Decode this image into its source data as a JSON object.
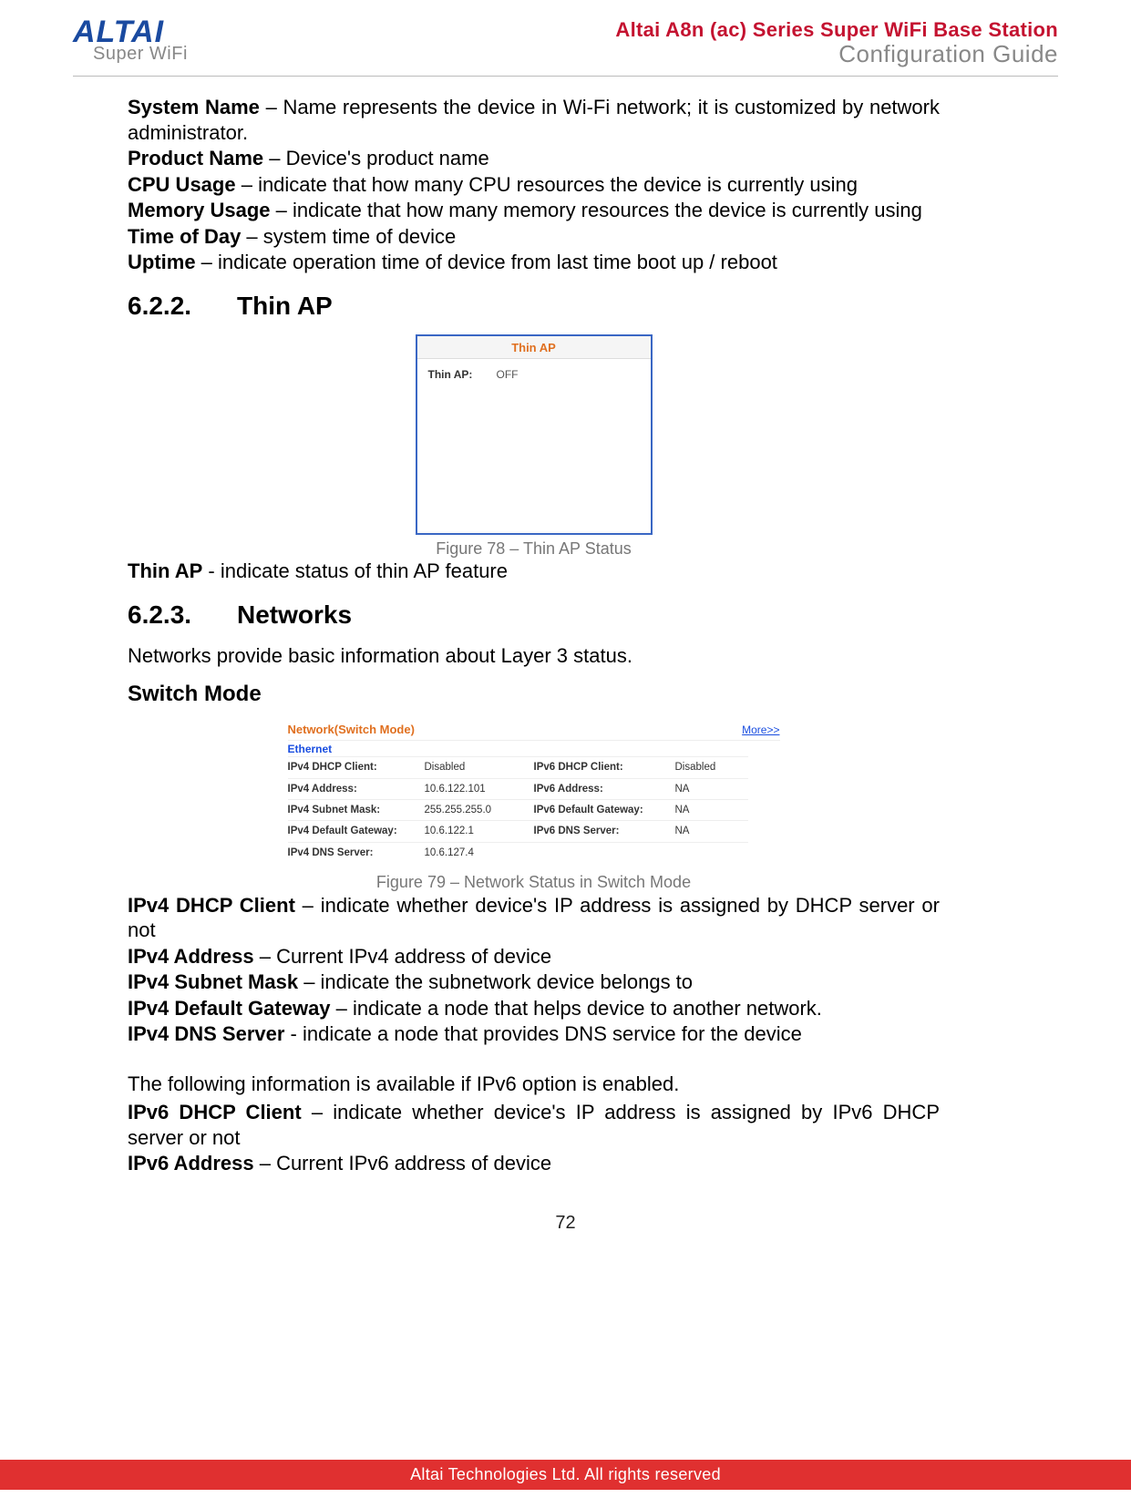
{
  "header": {
    "logo_main": "ALTAI",
    "logo_sub": "Super WiFi",
    "title1": "Altai A8n (ac) Series Super WiFi Base Station",
    "title2": "Configuration Guide"
  },
  "defs1": [
    {
      "term": "System Name",
      "sep": " – ",
      "text": "Name represents the device in Wi-Fi network; it is customized by network administrator."
    },
    {
      "term": "Product Name",
      "sep": " – ",
      "text": "Device's product name"
    },
    {
      "term": "CPU Usage",
      "sep": " – ",
      "text": "indicate that how many CPU resources the device is currently using"
    },
    {
      "term": "Memory Usage",
      "sep": " – ",
      "text": "indicate that how many memory resources the device is currently using"
    },
    {
      "term": "Time of Day",
      "sep": " – ",
      "text": "system time of device"
    },
    {
      "term": "Uptime",
      "sep": " – ",
      "text": "indicate operation time of device from last time boot up / reboot"
    }
  ],
  "section_622": {
    "num": "6.2.2.",
    "title": "Thin AP"
  },
  "thinap_panel": {
    "heading": "Thin AP",
    "label": "Thin AP:",
    "value": "OFF"
  },
  "fig78": "Figure 78 – Thin AP Status",
  "def_thinap": {
    "term": "Thin AP",
    "sep": " - ",
    "text": "indicate status of thin AP feature"
  },
  "section_623": {
    "num": "6.2.3.",
    "title": "Networks"
  },
  "networks_intro": "Networks provide basic information about Layer 3 status.",
  "switch_mode_heading": "Switch Mode",
  "net_panel": {
    "heading": "Network(Switch Mode)",
    "more": "More>>",
    "ethernet": "Ethernet",
    "rows": [
      {
        "l1": "IPv4 DHCP Client:",
        "v1": "Disabled",
        "l2": "IPv6 DHCP Client:",
        "v2": "Disabled"
      },
      {
        "l1": "IPv4 Address:",
        "v1": "10.6.122.101",
        "l2": "IPv6 Address:",
        "v2": "NA"
      },
      {
        "l1": "IPv4 Subnet Mask:",
        "v1": "255.255.255.0",
        "l2": "IPv6 Default Gateway:",
        "v2": "NA"
      },
      {
        "l1": "IPv4 Default Gateway:",
        "v1": "10.6.122.1",
        "l2": "IPv6 DNS Server:",
        "v2": "NA"
      },
      {
        "l1": "IPv4 DNS Server:",
        "v1": "10.6.127.4",
        "l2": "",
        "v2": ""
      }
    ]
  },
  "fig79": "Figure 79 – Network Status in Switch Mode",
  "defs2": [
    {
      "term": "IPv4 DHCP Client",
      "sep": " – ",
      "text": "indicate whether device's IP address is assigned by DHCP server or not"
    },
    {
      "term": "IPv4 Address",
      "sep": " – ",
      "text": "Current IPv4 address of device"
    },
    {
      "term": "IPv4 Subnet Mask",
      "sep": " – ",
      "text": "indicate the subnetwork device belongs to"
    },
    {
      "term": "IPv4 Default Gateway",
      "sep": " – ",
      "text": "indicate a node that helps device to another network."
    },
    {
      "term": "IPv4 DNS Server",
      "sep": " - ",
      "text": "indicate a node that provides DNS service for the device"
    }
  ],
  "ipv6_intro": "The following information is available if IPv6 option is enabled.",
  "defs3": [
    {
      "term": "IPv6 DHCP Client",
      "sep": " – ",
      "text": "indicate whether device's IP address is assigned by IPv6 DHCP server or not"
    },
    {
      "term": "IPv6 Address",
      "sep": " – ",
      "text": "Current IPv6 address of device"
    }
  ],
  "page_number": "72",
  "footer": "Altai Technologies Ltd. All rights reserved"
}
